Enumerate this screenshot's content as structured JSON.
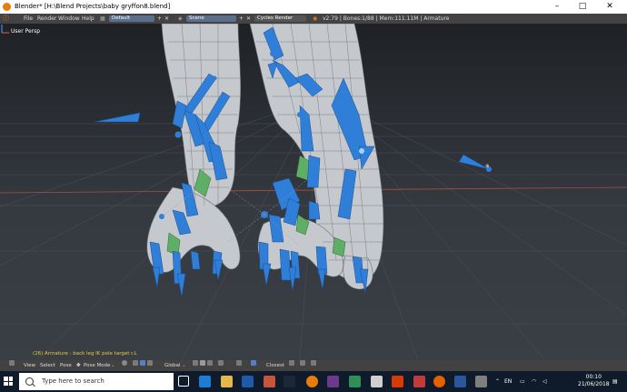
{
  "window": {
    "title": "Blender* [H:\\Blend Projects\\baby gryffon8.blend]",
    "minimize": "–",
    "maximize": "□",
    "close": "✕"
  },
  "infobar": {
    "menus": [
      "File",
      "Render",
      "Window",
      "Help"
    ],
    "layout": "Default",
    "scene": "Scene",
    "engine": "Cycles Render",
    "stats": "v2.79 | Bones:1/88 | Mem:111.11M | Armature"
  },
  "viewport": {
    "label": "User Persp",
    "status": "(26) Armature : back leg IK pole target r.L"
  },
  "header3d": {
    "menus": [
      "View",
      "Select",
      "Pose"
    ],
    "mode": "Pose Mode",
    "orientation": "Global",
    "snap": "Closest"
  },
  "taskbar": {
    "search_placeholder": "Type here to search",
    "language": "EN",
    "time": "00:10",
    "date": "21/06/2018"
  },
  "colors": {
    "bone_blue": "#2f7fd8",
    "selected_green": "#5fae66",
    "grid_x_axis": "#a8503a",
    "status_text": "#e6cc3a"
  }
}
